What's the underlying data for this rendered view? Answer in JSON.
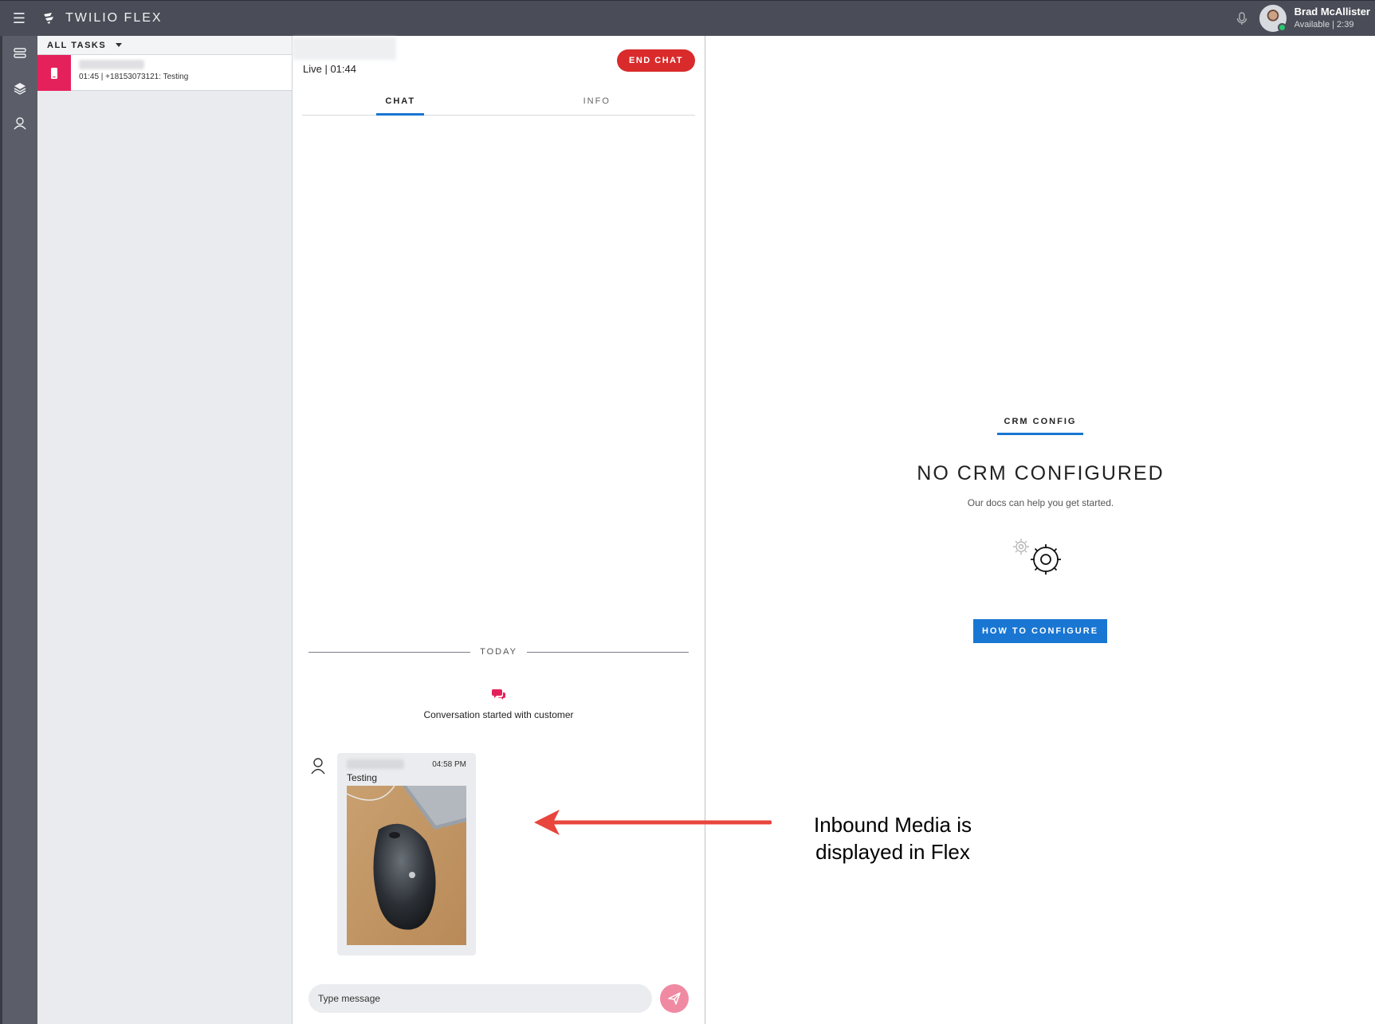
{
  "app": {
    "brand": "TWILIO FLEX",
    "user_name": "Brad McAllister",
    "user_status": "Available | 2:39"
  },
  "nav": {
    "menu_icon": "hamburger-icon",
    "rail_icons": [
      "task-list-icon",
      "layers-icon",
      "agent-icon"
    ]
  },
  "tasks": {
    "filter_label": "ALL TASKS",
    "items": [
      {
        "subtitle": "01:45 | +18153073121: Testing",
        "icon": "phone-icon"
      }
    ]
  },
  "chat": {
    "status": "Live | 01:44",
    "end_button": "END CHAT",
    "tabs": [
      "CHAT",
      "INFO"
    ],
    "active_tab": "CHAT",
    "day_divider": "TODAY",
    "conversation_notice": "Conversation started with customer",
    "message": {
      "time": "04:58 PM",
      "text": "Testing"
    },
    "input_placeholder": "Type message"
  },
  "crm": {
    "tab_label": "CRM CONFIG",
    "title": "NO CRM CONFIGURED",
    "subtitle": "Our docs can help you get started.",
    "button": "HOW TO CONFIGURE"
  },
  "annotation": {
    "line1": "Inbound Media is",
    "line2": "displayed in Flex"
  },
  "colors": {
    "topbar": "#4a4d57",
    "accent": "#1976d2",
    "task_pink": "#e5215b",
    "end_chat_red": "#d92b2b",
    "arrow_red": "#e8453c"
  }
}
